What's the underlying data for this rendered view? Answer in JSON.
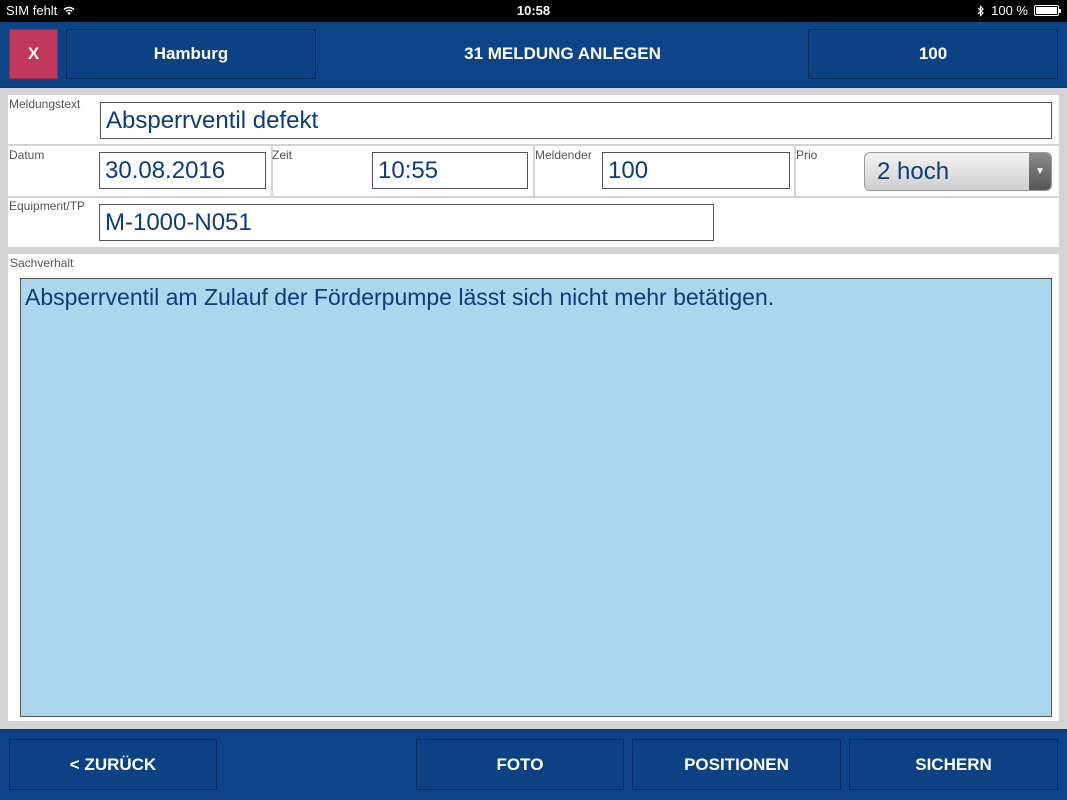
{
  "statusbar": {
    "carrier": "SIM fehlt",
    "time": "10:58",
    "battery": "100 %"
  },
  "header": {
    "close_label": "X",
    "location": "Hamburg",
    "title": "31 MELDUNG ANLEGEN",
    "user": "100"
  },
  "form": {
    "meldungstext": {
      "label": "Meldungstext",
      "value": "Absperrventil defekt"
    },
    "datum": {
      "label": "Datum",
      "value": "30.08.2016"
    },
    "zeit": {
      "label": "Zeit",
      "value": "10:55"
    },
    "meldender": {
      "label": "Meldender",
      "value": "100"
    },
    "prio": {
      "label": "Prio",
      "value": "2 hoch"
    },
    "equipment": {
      "label": "Equipment/TP",
      "value": "M-1000-N051"
    },
    "sachverhalt": {
      "label": "Sachverhalt",
      "value": "Absperrventil am Zulauf der Förderpumpe lässt sich nicht mehr betätigen."
    }
  },
  "footer": {
    "back_label": "< ZURÜCK",
    "foto_label": "FOTO",
    "positionen_label": "POSITIONEN",
    "sichern_label": "SICHERN"
  },
  "colors": {
    "header_bg": "#0d4488",
    "close_bg": "#c0395a",
    "textarea_bg": "#acd6ee",
    "field_text": "#0c3d78"
  }
}
